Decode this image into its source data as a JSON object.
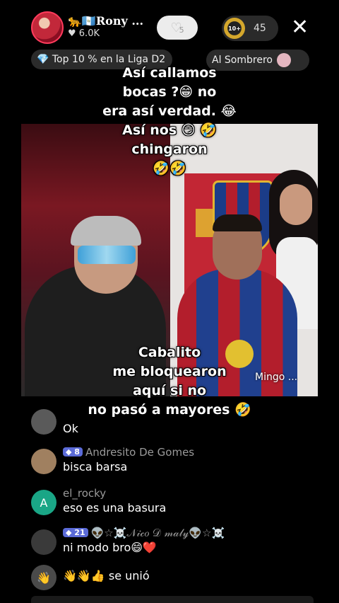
{
  "header": {
    "host_name": "🐆🇬🇹Rony ...",
    "host_likes": "♥ 6.0K",
    "follow_count": "5",
    "viewer_badge": "10+",
    "viewer_count": "45",
    "league_label": "💎 Top 10 % en la Liga D2",
    "gift_label": "Al Sombrero"
  },
  "captions": {
    "top": [
      "Así callamos",
      "bocas ?😁 no",
      "era así verdad. 😂",
      "Así nos 😏 🤣",
      "chingaron",
      "🤣🤣"
    ],
    "bottom": [
      "Cabalito",
      "me bloquearon",
      "aquí si no",
      "no pasó a mayores 🤣"
    ]
  },
  "video": {
    "right_label": "Mingo ..."
  },
  "comments": [
    {
      "name": "",
      "level": "",
      "text": "Ok",
      "avatar_color": "#5a5a5a"
    },
    {
      "name": "Andresito De Gomes",
      "level": "8",
      "text": "bisca barsa",
      "avatar_color": "#a08060"
    },
    {
      "name": "el_rocky",
      "level": "",
      "text": "eso es una basura",
      "avatar_color": "#1aa686",
      "avatar_letter": "A"
    },
    {
      "name": "👽☆☠️𝒩𝒾𝒸𝑜 𝒟 𝓂𝒶𝓁𝓎👽☆☠️",
      "level": "21",
      "text": "ni modo bro😄❤️",
      "avatar_color": "#3a3a3a"
    },
    {
      "name": "",
      "level": "",
      "text": "👋👋👍 se unió",
      "avatar_color": "#4a4a4a"
    }
  ]
}
